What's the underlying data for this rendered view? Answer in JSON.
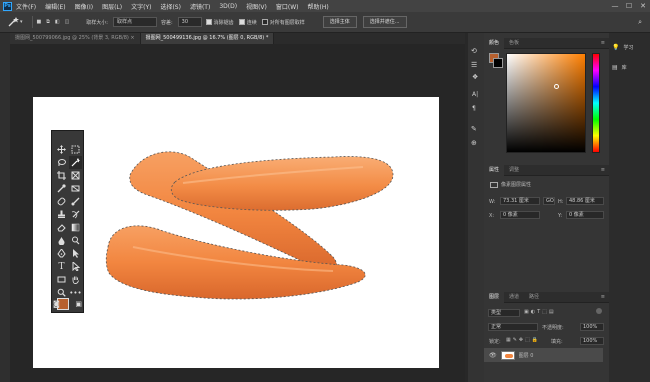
{
  "menubar": {
    "app_logo": "Ps",
    "items": [
      "文件(F)",
      "编辑(E)",
      "图像(I)",
      "图层(L)",
      "文字(Y)",
      "选择(S)",
      "滤镜(T)",
      "3D(D)",
      "视图(V)",
      "窗口(W)",
      "帮助(H)"
    ],
    "minimize": "—",
    "maximize": "☐",
    "close": "✕"
  },
  "options": {
    "brush_size": "30",
    "size_label": "取样大小:",
    "size_value": "取样点",
    "tolerance_label": "容差:",
    "tolerance_value": "30",
    "antialias": "消除锯齿",
    "contiguous": "连续",
    "sample_all": "对所有图层取样",
    "select_subject": "选择主体",
    "select_mask": "选择并遮住..."
  },
  "tabs": [
    {
      "label": "摄图网_500799066.jpg @ 25% (背景 3, RGB/8) ×",
      "active": false
    },
    {
      "label": "摄图网_500499136.jpg @ 16.7% (图层 0, RGB/8) *",
      "active": true
    }
  ],
  "colors": {
    "accent": "#31a8ff",
    "foreground": "#b7602e",
    "background": "#000000",
    "picker_hue": "#ff7f00"
  },
  "color_panel": {
    "tab_color": "颜色",
    "tab_swatches": "色板"
  },
  "properties_panel": {
    "tab_properties": "属性",
    "tab_adjust": "调整",
    "layer_props": "像素图层属性",
    "w_label": "W:",
    "w_value": "73.31 厘米",
    "link": "GO",
    "h_label": "H:",
    "h_value": "48.86 厘米",
    "x_label": "X:",
    "x_value": "0 像素",
    "y_label": "Y:",
    "y_value": "0 像素"
  },
  "layers_panel": {
    "tab_layers": "图层",
    "tab_channels": "通道",
    "tab_paths": "路径",
    "kind": "类型",
    "blend_mode": "正常",
    "opacity_label": "不透明度:",
    "opacity_value": "100%",
    "lock_label": "锁定:",
    "fill_label": "填充:",
    "fill_value": "100%",
    "layer_name": "图层 0"
  },
  "far_right": {
    "learn": "学习",
    "library": "库"
  }
}
